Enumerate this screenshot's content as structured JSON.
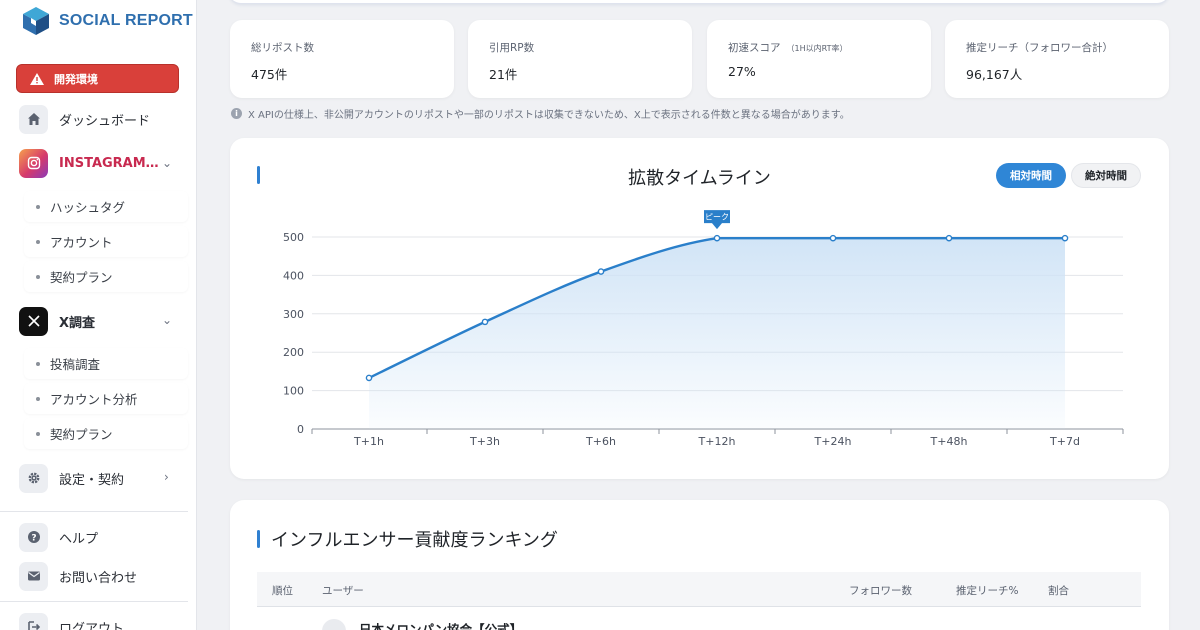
{
  "app": {
    "logo_text": "SOCIAL REPORT",
    "env_badge": "開発環境"
  },
  "sidebar": {
    "dashboard": "ダッシュボード",
    "instagram": {
      "label": "INSTAGRAM…",
      "items": [
        "ハッシュタグ",
        "アカウント",
        "契約プラン"
      ]
    },
    "x": {
      "label": "X調査",
      "items": [
        "投稿調査",
        "アカウント分析",
        "契約プラン"
      ]
    },
    "settings": "設定・契約",
    "help": "ヘルプ",
    "contact": "お問い合わせ",
    "logout": "ログアウト"
  },
  "stats": [
    {
      "label": "総リポスト数",
      "note": "",
      "value": "475件"
    },
    {
      "label": "引用RP数",
      "note": "",
      "value": "21件"
    },
    {
      "label": "初速スコア",
      "note": "（1H以内RT率）",
      "value": "27%"
    },
    {
      "label": "推定リーチ（フォロワー合計）",
      "note": "",
      "value": "96,167人"
    }
  ],
  "notice": "X APIの仕様上、非公開アカウントのリポストや一部のリポストは収集できないため、X上で表示される件数と異なる場合があります。",
  "chart_section": {
    "title": "拡散タイムライン",
    "toggle_active": "相対時間",
    "toggle_inactive": "絶対時間"
  },
  "chart_data": {
    "type": "area",
    "title": "拡散タイムライン",
    "categories": [
      "T+1h",
      "T+3h",
      "T+6h",
      "T+12h",
      "T+24h",
      "T+48h",
      "T+7d"
    ],
    "series": [
      {
        "values": [
          133,
          279,
          410,
          497,
          497,
          497,
          497
        ]
      }
    ],
    "ylim": [
      0,
      500
    ],
    "yticks": [
      0,
      100,
      200,
      300,
      400,
      500
    ],
    "grid": true,
    "annotation": {
      "label": "ピーク",
      "category": "T+12h"
    },
    "line_color": "#2a7fca",
    "fill_color": "#cfe3f6"
  },
  "ranking": {
    "title": "インフルエンサー貢献度ランキング",
    "headers": [
      "順位",
      "ユーザー",
      "フォロワー数",
      "推定リーチ%",
      "割合"
    ],
    "first_user": "日本メロンパン協会【公式】"
  },
  "colors": {
    "accent": "#2f80d1",
    "danger": "#d9403a",
    "instagram": "#c8294f"
  }
}
